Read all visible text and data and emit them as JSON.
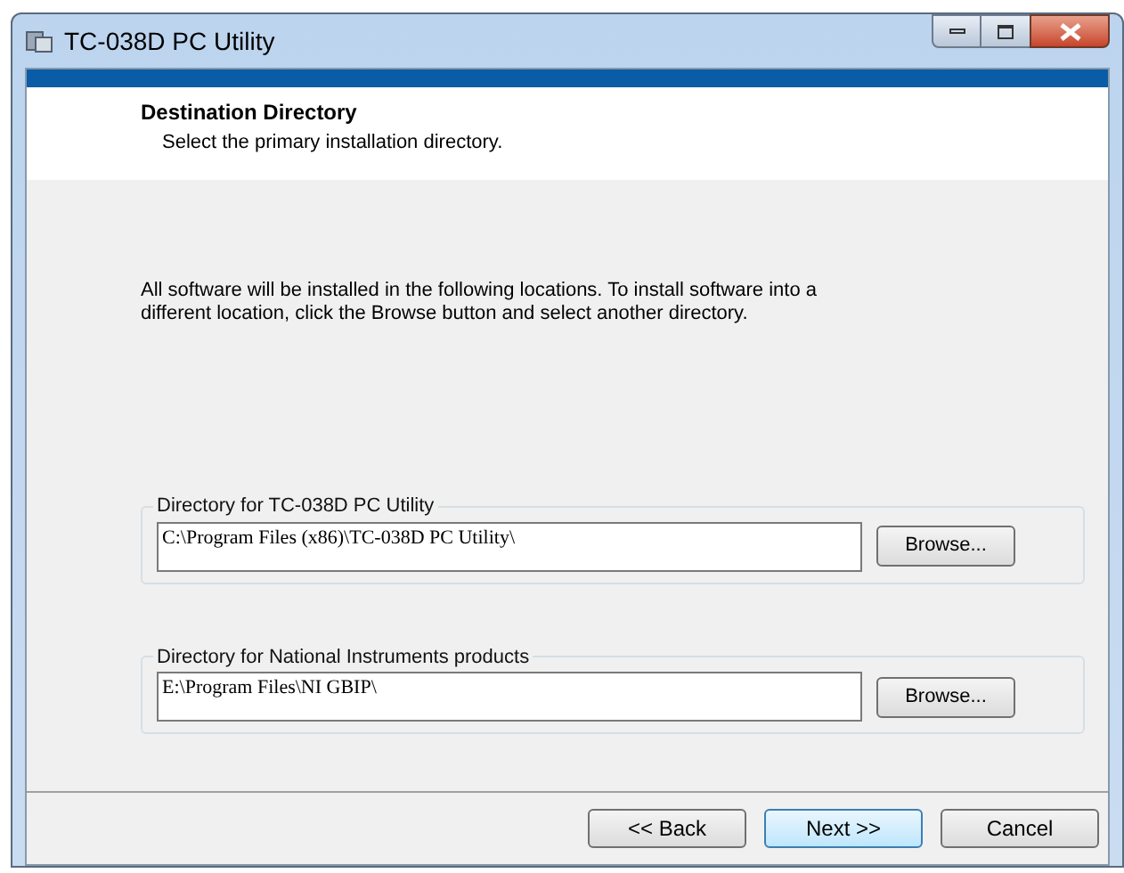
{
  "window": {
    "title": "TC-038D PC Utility"
  },
  "header": {
    "title": "Destination Directory",
    "subtitle": "Select the primary installation directory."
  },
  "intro": "All software will be installed in the following locations. To install software into a different location, click the Browse button and select another directory.",
  "directories": [
    {
      "label": "Directory for TC-038D PC Utility",
      "value": "C:\\Program Files (x86)\\TC-038D PC Utility\\",
      "button": "Browse..."
    },
    {
      "label": "Directory for National Instruments products",
      "value": "E:\\Program Files\\NI GBIP\\",
      "button": "Browse..."
    }
  ],
  "buttons": [
    {
      "label": "<< Back",
      "default": false
    },
    {
      "label": "Next >>",
      "default": true
    },
    {
      "label": "Cancel",
      "default": false
    }
  ]
}
